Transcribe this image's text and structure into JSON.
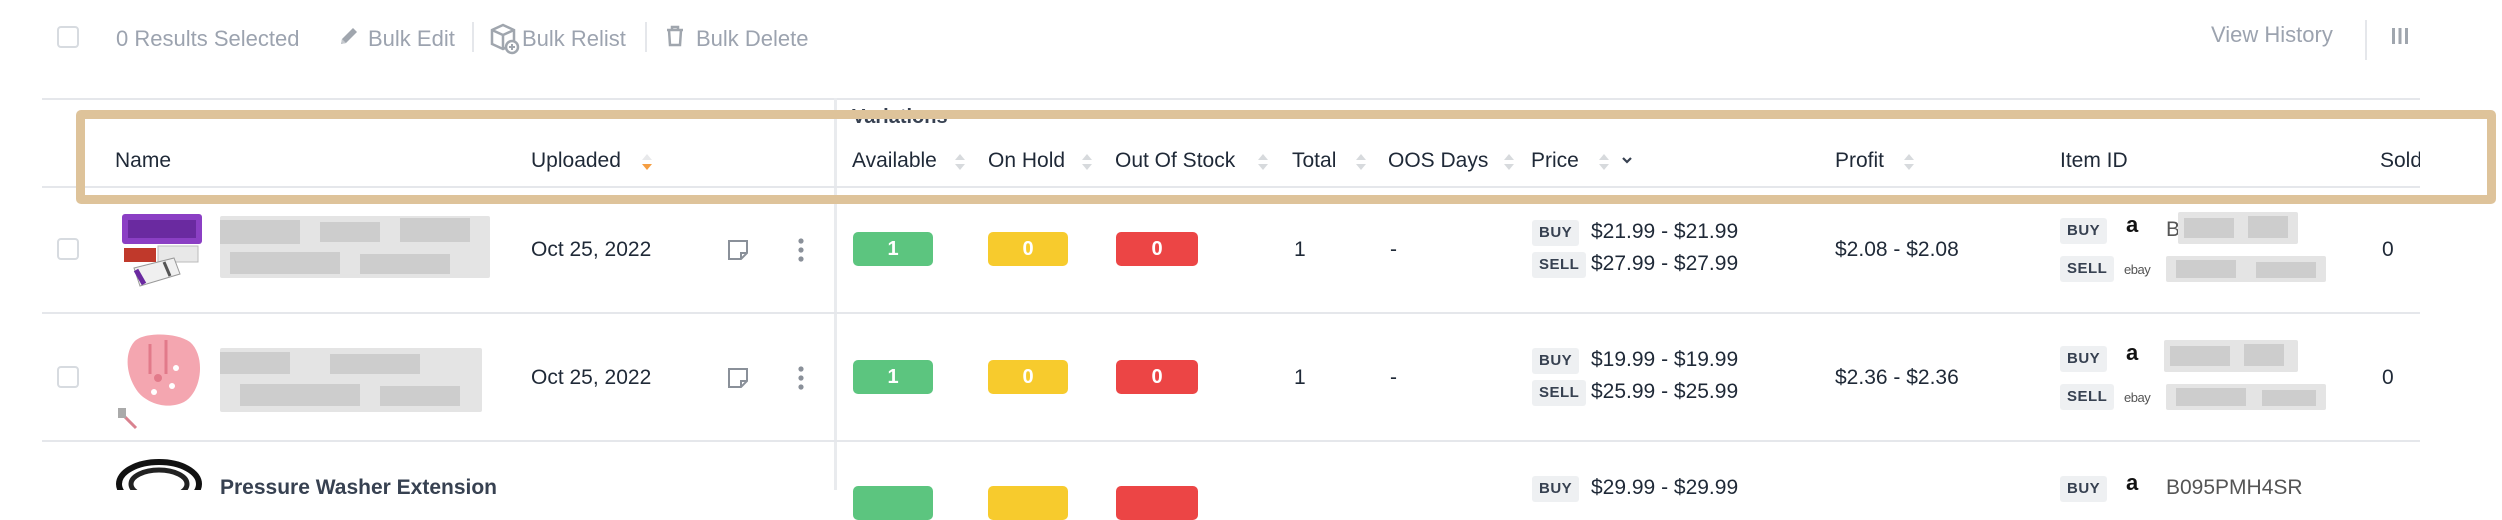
{
  "toolbar": {
    "results_selected": "0 Results Selected",
    "bulk_edit": "Bulk Edit",
    "bulk_relist": "Bulk Relist",
    "bulk_delete": "Bulk Delete",
    "view_history": "View History"
  },
  "group_header": "Variations",
  "columns": {
    "name": "Name",
    "uploaded": "Uploaded",
    "available": "Available",
    "on_hold": "On Hold",
    "out_of_stock": "Out Of Stock",
    "total": "Total",
    "oos_days": "OOS Days",
    "price": "Price",
    "profit": "Profit",
    "item_id": "Item ID",
    "sold": "Sold"
  },
  "tags": {
    "buy": "BUY",
    "sell": "SELL"
  },
  "marketplaces": {
    "amazon_glyph": "a",
    "ebay_label": "ebay"
  },
  "rows": [
    {
      "uploaded": "Oct 25, 2022",
      "available": "1",
      "on_hold": "0",
      "out_of_stock": "0",
      "total": "1",
      "oos_days": "-",
      "buy_price": "$21.99 - $21.99",
      "sell_price": "$27.99 - $27.99",
      "profit": "$2.08 - $2.08",
      "buy_id_prefix": "B",
      "sold": "0"
    },
    {
      "uploaded": "Oct 25, 2022",
      "available": "1",
      "on_hold": "0",
      "out_of_stock": "0",
      "total": "1",
      "oos_days": "-",
      "buy_price": "$19.99 - $19.99",
      "sell_price": "$25.99 - $25.99",
      "profit": "$2.36 - $2.36",
      "sold": "0"
    },
    {
      "name": "Pressure Washer Extension",
      "buy_price": "$29.99 - $29.99",
      "buy_id": "B095PMH4SR"
    }
  ],
  "colors": {
    "available": "#5cc57f",
    "on_hold": "#f7cb2d",
    "out_of_stock": "#ec4545",
    "sort_active": "#f59e42",
    "highlight": "#dec39a"
  },
  "icons": [
    "pencil-icon",
    "box-relist-icon",
    "trash-icon",
    "columns-icon",
    "note-icon",
    "more-vertical-icon",
    "sort-icon",
    "chevron-down-icon",
    "amazon-logo",
    "ebay-logo"
  ]
}
